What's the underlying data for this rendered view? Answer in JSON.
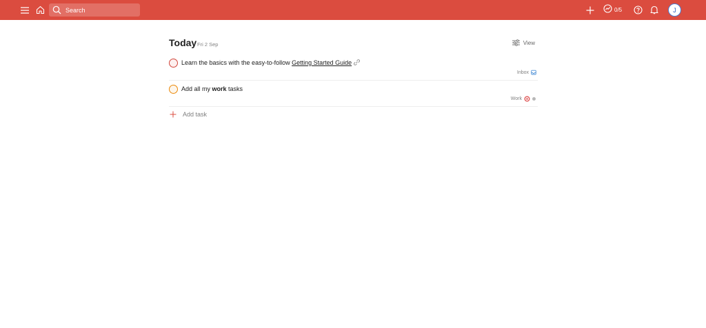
{
  "topbar": {
    "search_placeholder": "Search",
    "karma_progress": "0/5",
    "avatar_initial": "J",
    "icons": [
      "menu-icon",
      "home-icon",
      "search-icon",
      "add-icon",
      "productivity-icon",
      "help-icon",
      "bell-icon"
    ],
    "background_color": "#db4c3f"
  },
  "header": {
    "title": "Today",
    "date": "Fri 2 Sep",
    "view_label": "View"
  },
  "tasks": [
    {
      "text_before": "Learn the basics with the easy-to-follow ",
      "link_text": "Getting Started Guide",
      "project": "Inbox",
      "project_icon": "inbox-icon",
      "priority_color": "#d1453b"
    },
    {
      "text_before": "Add all my ",
      "bold_text": "work",
      "text_after": " tasks",
      "project": "Work",
      "project_icon": "target-icon",
      "priority_color": "#eb8909"
    }
  ],
  "add_task_label": "Add task"
}
